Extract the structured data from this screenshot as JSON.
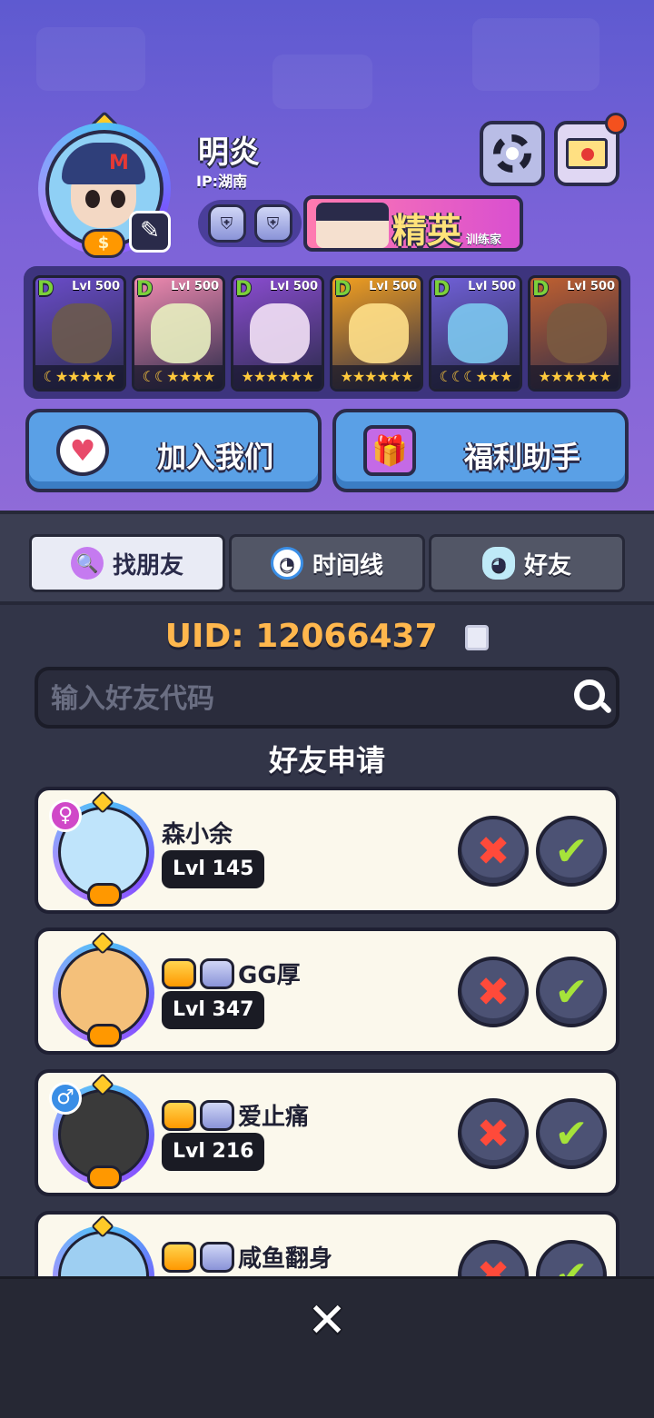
{
  "profile": {
    "name": "明炎",
    "ip": "IP:湖南",
    "rank_title": "精英",
    "rank_subtitle": "训练家"
  },
  "team": [
    {
      "grade": "D",
      "level": "Lvl 500",
      "color": "#6a4cc9",
      "body": "#6b5a4d",
      "stars": "☾★★★★★"
    },
    {
      "grade": "D",
      "level": "Lvl 500",
      "color": "#f08ab0",
      "body": "#e8f0c0",
      "stars": "☾☾★★★★"
    },
    {
      "grade": "D",
      "level": "Lvl 500",
      "color": "#8a4cd0",
      "body": "#f3e1f6",
      "stars": "★★★★★★"
    },
    {
      "grade": "D",
      "level": "Lvl 500",
      "color": "#f3a020",
      "body": "#ffe08a",
      "stars": "★★★★★★"
    },
    {
      "grade": "D",
      "level": "Lvl 500",
      "color": "#7060d8",
      "body": "#7cc8f0",
      "stars": "☾☾☾★★★"
    },
    {
      "grade": "D",
      "level": "Lvl 500",
      "color": "#c06030",
      "body": "#7a5a40",
      "stars": "★★★★★★"
    }
  ],
  "actions": {
    "join_label": "加入我们",
    "welfare_label": "福利助手"
  },
  "tabs": [
    {
      "label": "找朋友",
      "icon": "magnifier-icon",
      "active": true
    },
    {
      "label": "时间线",
      "icon": "clock-icon",
      "active": false
    },
    {
      "label": "好友",
      "icon": "ghost-chat-icon",
      "active": false
    }
  ],
  "uid": {
    "label": "UID:",
    "value": "12066437"
  },
  "search": {
    "placeholder": "输入好友代码"
  },
  "section_title": "好友申请",
  "requests": [
    {
      "name": "森小余",
      "level": "Lvl 145",
      "gender": "♀",
      "badges": [],
      "avatar_color": "#bfe4fb"
    },
    {
      "name": "GG厚",
      "level": "Lvl 347",
      "gender": "",
      "badges": [
        "gold",
        "silver"
      ],
      "avatar_color": "#f4c07a"
    },
    {
      "name": "爱止痛",
      "level": "Lvl 216",
      "gender": "♂",
      "badges": [
        "gold",
        "silver"
      ],
      "avatar_color": "#3a3a3a"
    },
    {
      "name": "咸鱼翻身",
      "level": "",
      "gender": "",
      "badges": [
        "gold",
        "silver"
      ],
      "avatar_color": "#9ecff2"
    }
  ],
  "accent_colors": {
    "orange_uid": "#ffb74d",
    "accept_green": "#a6e33a",
    "reject_red": "#ff4a3a"
  }
}
